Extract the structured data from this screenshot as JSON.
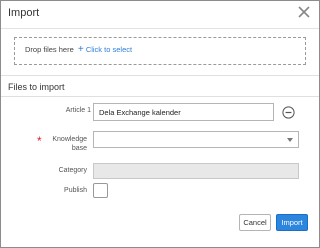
{
  "dialog": {
    "title": "Import"
  },
  "dropzone": {
    "text": "Drop files here",
    "link_label": "Click to select"
  },
  "files_section": {
    "title": "Files to import",
    "article_label": "Article 1",
    "article_value": "Dela Exchange kalender",
    "knowledge_base_label_line1": "Knowledge",
    "knowledge_base_label_line2": "base",
    "knowledge_base_value": "",
    "category_label": "Category",
    "publish_label": "Publish",
    "publish_checked": false
  },
  "footer": {
    "cancel_label": "Cancel",
    "import_label": "Import"
  },
  "colors": {
    "primary": "#2d86de",
    "link": "#2f7ed8",
    "required": "#dd2222"
  }
}
